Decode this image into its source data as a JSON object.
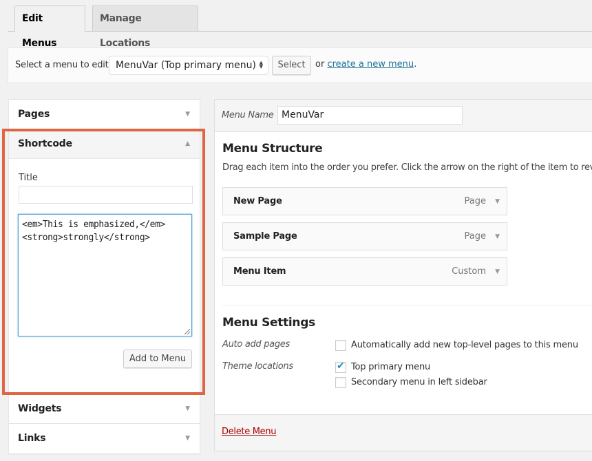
{
  "tabs": [
    {
      "label": "Edit Menus",
      "active": true
    },
    {
      "label": "Manage Locations",
      "active": false
    }
  ],
  "select_bar": {
    "label": "Select a menu to edit:",
    "selected_menu": "MenuVar (Top primary menu)",
    "select_button": "Select",
    "or_text": "or",
    "create_link": "create a new menu",
    "period": "."
  },
  "accordion": {
    "sections": [
      {
        "label": "Pages",
        "expanded": false
      },
      {
        "label": "Shortcode",
        "expanded": true
      },
      {
        "label": "Widgets",
        "expanded": false
      },
      {
        "label": "Links",
        "expanded": false
      }
    ],
    "shortcode": {
      "title_label": "Title",
      "title_value": "",
      "code_value": "<em>This is emphasized,</em>\n<strong>strongly</strong>",
      "add_button": "Add to Menu"
    },
    "highlight_color": "#dd6644"
  },
  "menu_editor": {
    "menu_name_label": "Menu Name",
    "menu_name_value": "MenuVar",
    "structure_title": "Menu Structure",
    "structure_desc": "Drag each item into the order you prefer. Click the arrow on the right of the item to reveal a",
    "items": [
      {
        "title": "New Page",
        "type": "Page"
      },
      {
        "title": "Sample Page",
        "type": "Page"
      },
      {
        "title": "Menu Item",
        "type": "Custom"
      }
    ],
    "settings_title": "Menu Settings",
    "auto_add_label": "Auto add pages",
    "auto_add_option": {
      "label": "Automatically add new top-level pages to this menu",
      "checked": false
    },
    "theme_locations_label": "Theme locations",
    "locations": [
      {
        "label": "Top primary menu",
        "checked": true
      },
      {
        "label": "Secondary menu in left sidebar",
        "checked": false
      }
    ],
    "delete_link": "Delete Menu"
  },
  "icons": {
    "caret_down": "▼",
    "caret_up": "▲",
    "select_arrows_up": "▲",
    "select_arrows_down": "▼",
    "checkmark": "✔"
  },
  "colors": {
    "link": "#21759b",
    "delete": "#aa0000",
    "focus": "#5b9dd9",
    "check": "#1e8cbe"
  }
}
